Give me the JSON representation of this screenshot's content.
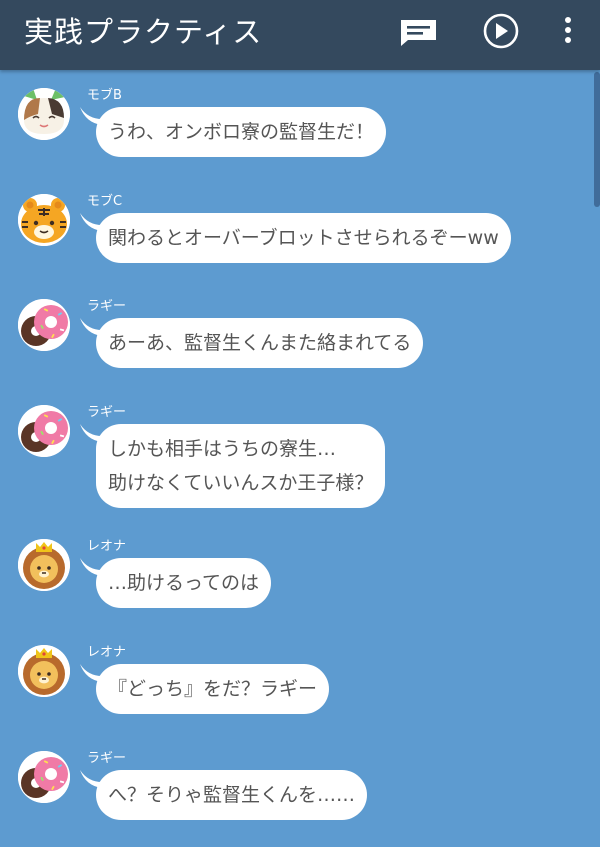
{
  "app": {
    "title": "実践プラクティス",
    "toolbar": {
      "message_icon": "message-icon",
      "play_icon": "play-icon",
      "more_icon": "more-vert-icon"
    },
    "colors": {
      "header": "#34495e",
      "background": "#5d9bd0",
      "bubble": "#ffffff",
      "text": "#555555"
    }
  },
  "messages": [
    {
      "speaker": "モブB",
      "avatar": "calico-cat-avatar",
      "lines": [
        "うわ、オンボロ寮の監督生だ！"
      ]
    },
    {
      "speaker": "モブC",
      "avatar": "tiger-avatar",
      "lines": [
        "関わるとオーバーブロットさせられるぞーww"
      ]
    },
    {
      "speaker": "ラギー",
      "avatar": "donut-avatar",
      "lines": [
        "あーあ、監督生くんまた絡まれてる"
      ]
    },
    {
      "speaker": "ラギー",
      "avatar": "donut-avatar",
      "lines": [
        "しかも相手はうちの寮生…",
        "助けなくていいんスか王子様？"
      ]
    },
    {
      "speaker": "レオナ",
      "avatar": "lion-avatar",
      "lines": [
        "…助けるってのは"
      ]
    },
    {
      "speaker": "レオナ",
      "avatar": "lion-avatar",
      "lines": [
        "『どっち』をだ？ラギー"
      ]
    },
    {
      "speaker": "ラギー",
      "avatar": "donut-avatar",
      "lines": [
        "へ？そりゃ監督生くんを……"
      ]
    }
  ]
}
